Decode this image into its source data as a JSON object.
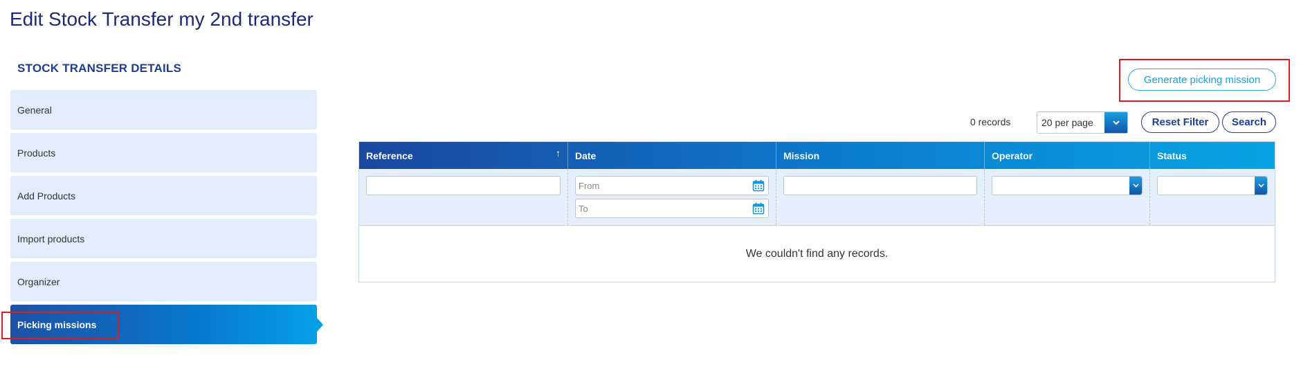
{
  "page": {
    "title": "Edit Stock Transfer my 2nd transfer"
  },
  "sidebar": {
    "section_title": "STOCK TRANSFER DETAILS",
    "items": [
      {
        "label": "General"
      },
      {
        "label": "Products"
      },
      {
        "label": "Add Products"
      },
      {
        "label": "Import products"
      },
      {
        "label": "Organizer"
      },
      {
        "label": "Picking missions",
        "active": true
      }
    ]
  },
  "actions": {
    "generate_label": "Generate picking mission"
  },
  "toolbar": {
    "records_text": "0 records",
    "per_page_value": "20 per page",
    "reset_label": "Reset Filter",
    "search_label": "Search"
  },
  "grid": {
    "columns": [
      "Reference",
      "Date",
      "Mission",
      "Operator",
      "Status"
    ],
    "sort_indicator": "↑",
    "date_from_placeholder": "From",
    "date_to_placeholder": "To",
    "empty_message": "We couldn't find any records."
  },
  "colors": {
    "title": "#1b2a7a",
    "accent_blue": "#1d3c97",
    "light_blue": "#1aa0dc",
    "sidebar_bg": "#e1edfb",
    "highlight_red": "#e01b1b"
  },
  "icons": {
    "sort": "arrow-up-icon",
    "calendar": "calendar-icon",
    "dropdown": "chevron-down-icon"
  }
}
